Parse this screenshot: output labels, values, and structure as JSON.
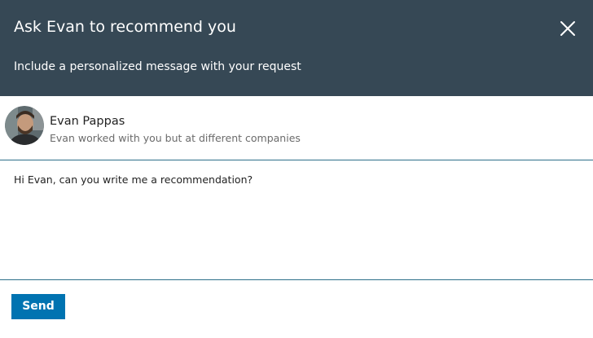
{
  "dialog": {
    "title": "Ask Evan to recommend you",
    "subtitle": "Include a personalized message with your request",
    "close_icon": "close-icon"
  },
  "recipient": {
    "name": "Evan Pappas",
    "relation": "Evan worked with you but at different companies",
    "avatar_icon": "avatar-photo"
  },
  "message": {
    "value": "Hi Evan, can you write me a recommendation?"
  },
  "footer": {
    "send_label": "Send"
  },
  "colors": {
    "header_bg": "#364855",
    "divider": "#2d6f89",
    "send_button": "#0073b1"
  }
}
